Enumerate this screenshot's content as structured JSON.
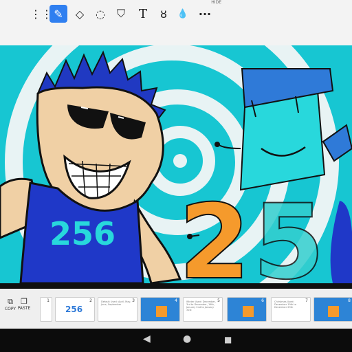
{
  "toolbar": {
    "hide_label": "HIDE",
    "tools": [
      {
        "icon": "handle-grip-icon",
        "glyph": "⋮⋮"
      },
      {
        "icon": "pen-icon",
        "glyph": "✎",
        "active": true
      },
      {
        "icon": "eraser-icon",
        "glyph": "◇"
      },
      {
        "icon": "lasso-icon",
        "glyph": "◌"
      },
      {
        "icon": "paint-bucket-icon",
        "glyph": "⛉"
      },
      {
        "icon": "text-icon",
        "glyph": "T"
      },
      {
        "icon": "smudge-icon",
        "glyph": "ȣ"
      },
      {
        "icon": "dropper-icon",
        "glyph": "💧"
      },
      {
        "icon": "more-icon",
        "glyph": "···"
      }
    ],
    "accent": "#2f7ff0"
  },
  "canvas": {
    "shirt_number": "256",
    "big_digit_2": "2",
    "big_digit_5": "5",
    "colors": {
      "bg": "#17c6d2",
      "ring": "#e8f3f4",
      "shirt": "#1f38c8",
      "skin": "#f0d0a5",
      "hair": "#2039c2",
      "orange": "#f59a2c",
      "cyan": "#28d8dc",
      "hat": "#2f7ad8"
    }
  },
  "strip": {
    "left_buttons": [
      {
        "label": "COPY",
        "icon": "copy-icon"
      },
      {
        "label": "PASTE",
        "icon": "paste-icon"
      }
    ],
    "slides": [
      {
        "num": "1",
        "caption": ""
      },
      {
        "num": "2",
        "caption": "256"
      },
      {
        "num": "3",
        "caption": "Default\nUsed: April, May, June, September"
      },
      {
        "num": "4",
        "caption": ""
      },
      {
        "num": "5",
        "caption": "Winter\nUsed: December, 3rd to December, 19th, January 2nd to January 31st"
      },
      {
        "num": "6",
        "caption": ""
      },
      {
        "num": "7",
        "caption": "Christmas\nUsed: December 19th to December 29th"
      },
      {
        "num": "8",
        "caption": ""
      }
    ]
  },
  "nav": {
    "back": "◀",
    "home": "●",
    "recents": "■"
  }
}
